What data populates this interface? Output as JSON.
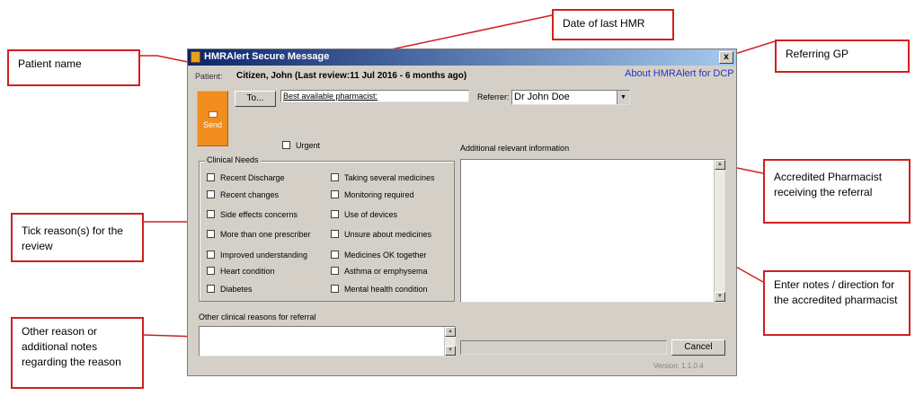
{
  "window": {
    "title": "HMRAlert Secure Message",
    "close_glyph": "x"
  },
  "patient": {
    "label": "Patient:",
    "value": "Citizen, John  (Last review:11 Jul 2016  - 6 months ago)"
  },
  "about_link": "About HMRAlert for DCP",
  "send_button": {
    "icon": "envelope-icon",
    "label": "Send"
  },
  "to_button": {
    "label": "To..."
  },
  "recipient_field": {
    "value": "Best available pharmacist:"
  },
  "referrer": {
    "label": "Referrer:",
    "value": "Dr John Doe"
  },
  "urgent": {
    "label": "Urgent"
  },
  "clinical_needs": {
    "title": "Clinical Needs",
    "left": [
      "Recent Discharge",
      "Recent changes",
      "Side effects concerns",
      "More than one prescriber",
      "Improved understanding",
      "Heart condition",
      "Diabetes"
    ],
    "right": [
      "Taking several medicines",
      "Monitoring required",
      "Use of devices",
      "Unsure about medicines",
      "Medicines OK together",
      "Asthma or emphysema",
      "Mental health condition"
    ]
  },
  "additional_info": {
    "label": "Additional relevant information"
  },
  "other_reasons": {
    "label": "Other clinical reasons for referral"
  },
  "cancel_button": {
    "label": "Cancel"
  },
  "version": "Version: 1.1.0.4",
  "callouts": {
    "patient_name": "Patient name",
    "date_last_hmr": "Date of last HMR",
    "referring_gp": "Referring GP",
    "accredited_pharmacist": "Accredited Pharmacist receiving the referral",
    "tick_reasons": "Tick reason(s) for the review",
    "enter_notes": "Enter notes / direction for the accredited pharmacist",
    "other_reason": "Other reason or additional notes regarding the reason"
  },
  "colors": {
    "accent": "#d02020",
    "send_orange": "#f08c20",
    "link_blue": "#2233cc",
    "title_bar": "#0a246a"
  }
}
